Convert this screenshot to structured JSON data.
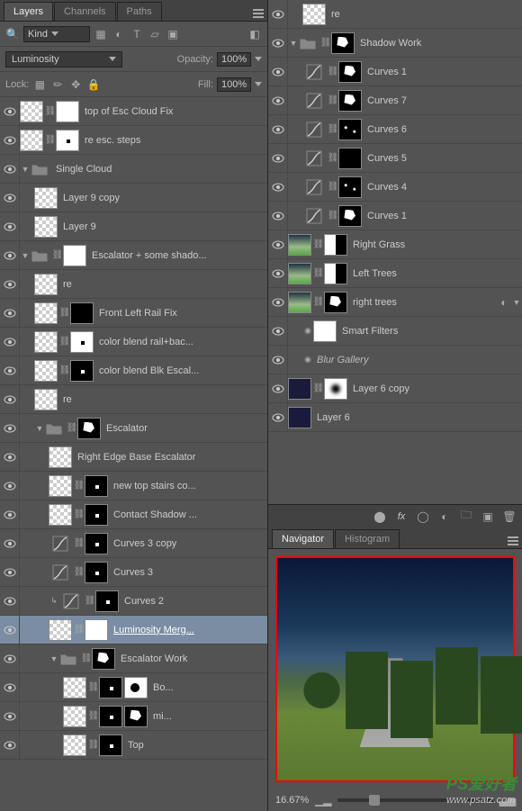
{
  "panel": {
    "tabs": [
      "Layers",
      "Channels",
      "Paths"
    ],
    "filter_kind": "Kind",
    "blend_mode": "Luminosity",
    "opacity_label": "Opacity:",
    "opacity_value": "100%",
    "lock_label": "Lock:",
    "fill_label": "Fill:",
    "fill_value": "100%"
  },
  "left_layers": [
    {
      "type": "layer",
      "name": "top of Esc Cloud Fix",
      "indent": 0,
      "thumbs": [
        "checker",
        "white"
      ],
      "link": true
    },
    {
      "type": "layer",
      "name": "re esc. steps",
      "indent": 0,
      "thumbs": [
        "checker",
        "white-dot"
      ],
      "link": true
    },
    {
      "type": "group",
      "name": "Single Cloud",
      "indent": 0,
      "open": true
    },
    {
      "type": "layer",
      "name": "Layer 9 copy",
      "indent": 1,
      "thumbs": [
        "checker"
      ]
    },
    {
      "type": "layer",
      "name": "Layer 9",
      "indent": 1,
      "thumbs": [
        "checker"
      ]
    },
    {
      "type": "group",
      "name": "Escalator + some shado...",
      "indent": 0,
      "open": true,
      "mask": "white",
      "link": true
    },
    {
      "type": "layer",
      "name": "re",
      "indent": 1,
      "thumbs": [
        "checker"
      ]
    },
    {
      "type": "layer",
      "name": "Front Left Rail Fix",
      "indent": 1,
      "thumbs": [
        "checker",
        "black"
      ],
      "link": true
    },
    {
      "type": "layer",
      "name": "color blend rail+bac...",
      "indent": 1,
      "thumbs": [
        "checker",
        "white-dot"
      ],
      "link": true
    },
    {
      "type": "layer",
      "name": "color blend Blk Escal...",
      "indent": 1,
      "thumbs": [
        "checker",
        "black-dot"
      ],
      "link": true
    },
    {
      "type": "layer",
      "name": "re",
      "indent": 1,
      "thumbs": [
        "checker"
      ]
    },
    {
      "type": "group",
      "name": "Escalator",
      "indent": 1,
      "open": true,
      "mask": "black-shape",
      "link": true
    },
    {
      "type": "layer",
      "name": "Right Edge Base Escalator",
      "indent": 2,
      "thumbs": [
        "checker"
      ]
    },
    {
      "type": "layer",
      "name": "new top stairs co...",
      "indent": 2,
      "thumbs": [
        "checker",
        "black-dot"
      ],
      "link": true
    },
    {
      "type": "layer",
      "name": "Contact Shadow ...",
      "indent": 2,
      "thumbs": [
        "checker",
        "black-dot"
      ],
      "link": true
    },
    {
      "type": "adj",
      "name": "Curves 3 copy",
      "indent": 2,
      "thumbs": [
        "curves",
        "black-dot"
      ],
      "link": true
    },
    {
      "type": "adj",
      "name": "Curves 3",
      "indent": 2,
      "thumbs": [
        "curves",
        "black-dot"
      ],
      "link": true
    },
    {
      "type": "adj",
      "name": "Curves 2",
      "indent": 2,
      "thumbs": [
        "curves",
        "black-dot"
      ],
      "link": true,
      "clip": true
    },
    {
      "type": "layer",
      "name": "Luminosity Merg...",
      "indent": 2,
      "thumbs": [
        "checker-sel",
        "white"
      ],
      "link": true,
      "selected": true
    },
    {
      "type": "group",
      "name": "Escalator Work",
      "indent": 2,
      "open": true,
      "mask": "black-shape",
      "link": true
    },
    {
      "type": "layer",
      "name": "Bo...",
      "indent": 3,
      "thumbs": [
        "checker",
        "black-dot",
        "white-shape"
      ],
      "link": true
    },
    {
      "type": "layer",
      "name": "mi...",
      "indent": 3,
      "thumbs": [
        "checker",
        "black-dot",
        "black-shape"
      ],
      "link": true
    },
    {
      "type": "layer",
      "name": "Top",
      "indent": 3,
      "thumbs": [
        "checker",
        "black-dot"
      ],
      "link": true
    }
  ],
  "right_layers": [
    {
      "type": "layer",
      "name": "re",
      "indent": 1,
      "thumbs": [
        "checker"
      ]
    },
    {
      "type": "group",
      "name": "Shadow Work",
      "indent": 0,
      "open": true,
      "mask": "black-shape",
      "link": true
    },
    {
      "type": "adj",
      "name": "Curves 1",
      "indent": 1,
      "thumbs": [
        "curves",
        "black-shape"
      ],
      "link": true
    },
    {
      "type": "adj",
      "name": "Curves 7",
      "indent": 1,
      "thumbs": [
        "curves",
        "black-shape"
      ],
      "link": true
    },
    {
      "type": "adj",
      "name": "Curves 6",
      "indent": 1,
      "thumbs": [
        "curves",
        "black-dots"
      ],
      "link": true
    },
    {
      "type": "adj",
      "name": "Curves 5",
      "indent": 1,
      "thumbs": [
        "curves",
        "black"
      ],
      "link": true
    },
    {
      "type": "adj",
      "name": "Curves 4",
      "indent": 1,
      "thumbs": [
        "curves",
        "black-dots"
      ],
      "link": true
    },
    {
      "type": "adj",
      "name": "Curves 1",
      "indent": 1,
      "thumbs": [
        "curves",
        "black-shape"
      ],
      "link": true
    },
    {
      "type": "layer",
      "name": "Right Grass",
      "indent": 0,
      "thumbs": [
        "grad",
        "black-white"
      ],
      "link": true
    },
    {
      "type": "layer",
      "name": "Left Trees",
      "indent": 0,
      "thumbs": [
        "grad",
        "white-black"
      ],
      "link": true
    },
    {
      "type": "smart",
      "name": "right trees",
      "indent": 0,
      "thumbs": [
        "grad",
        "black-shape"
      ],
      "link": true,
      "fx": true
    },
    {
      "type": "filter-head",
      "name": "Smart Filters",
      "indent": 1,
      "thumbs": [
        "white"
      ]
    },
    {
      "type": "filter",
      "name": "Blur Gallery",
      "indent": 1
    },
    {
      "type": "layer",
      "name": "Layer 6 copy",
      "indent": 0,
      "thumbs": [
        "dark",
        "white-circle"
      ],
      "link": true
    },
    {
      "type": "layer",
      "name": "Layer 6",
      "indent": 0,
      "thumbs": [
        "dark"
      ]
    }
  ],
  "nav": {
    "tabs": [
      "Navigator",
      "Histogram"
    ],
    "zoom": "16.67%"
  },
  "watermark_url": "www.psatz.com",
  "watermark_brand": "PS爱好者"
}
